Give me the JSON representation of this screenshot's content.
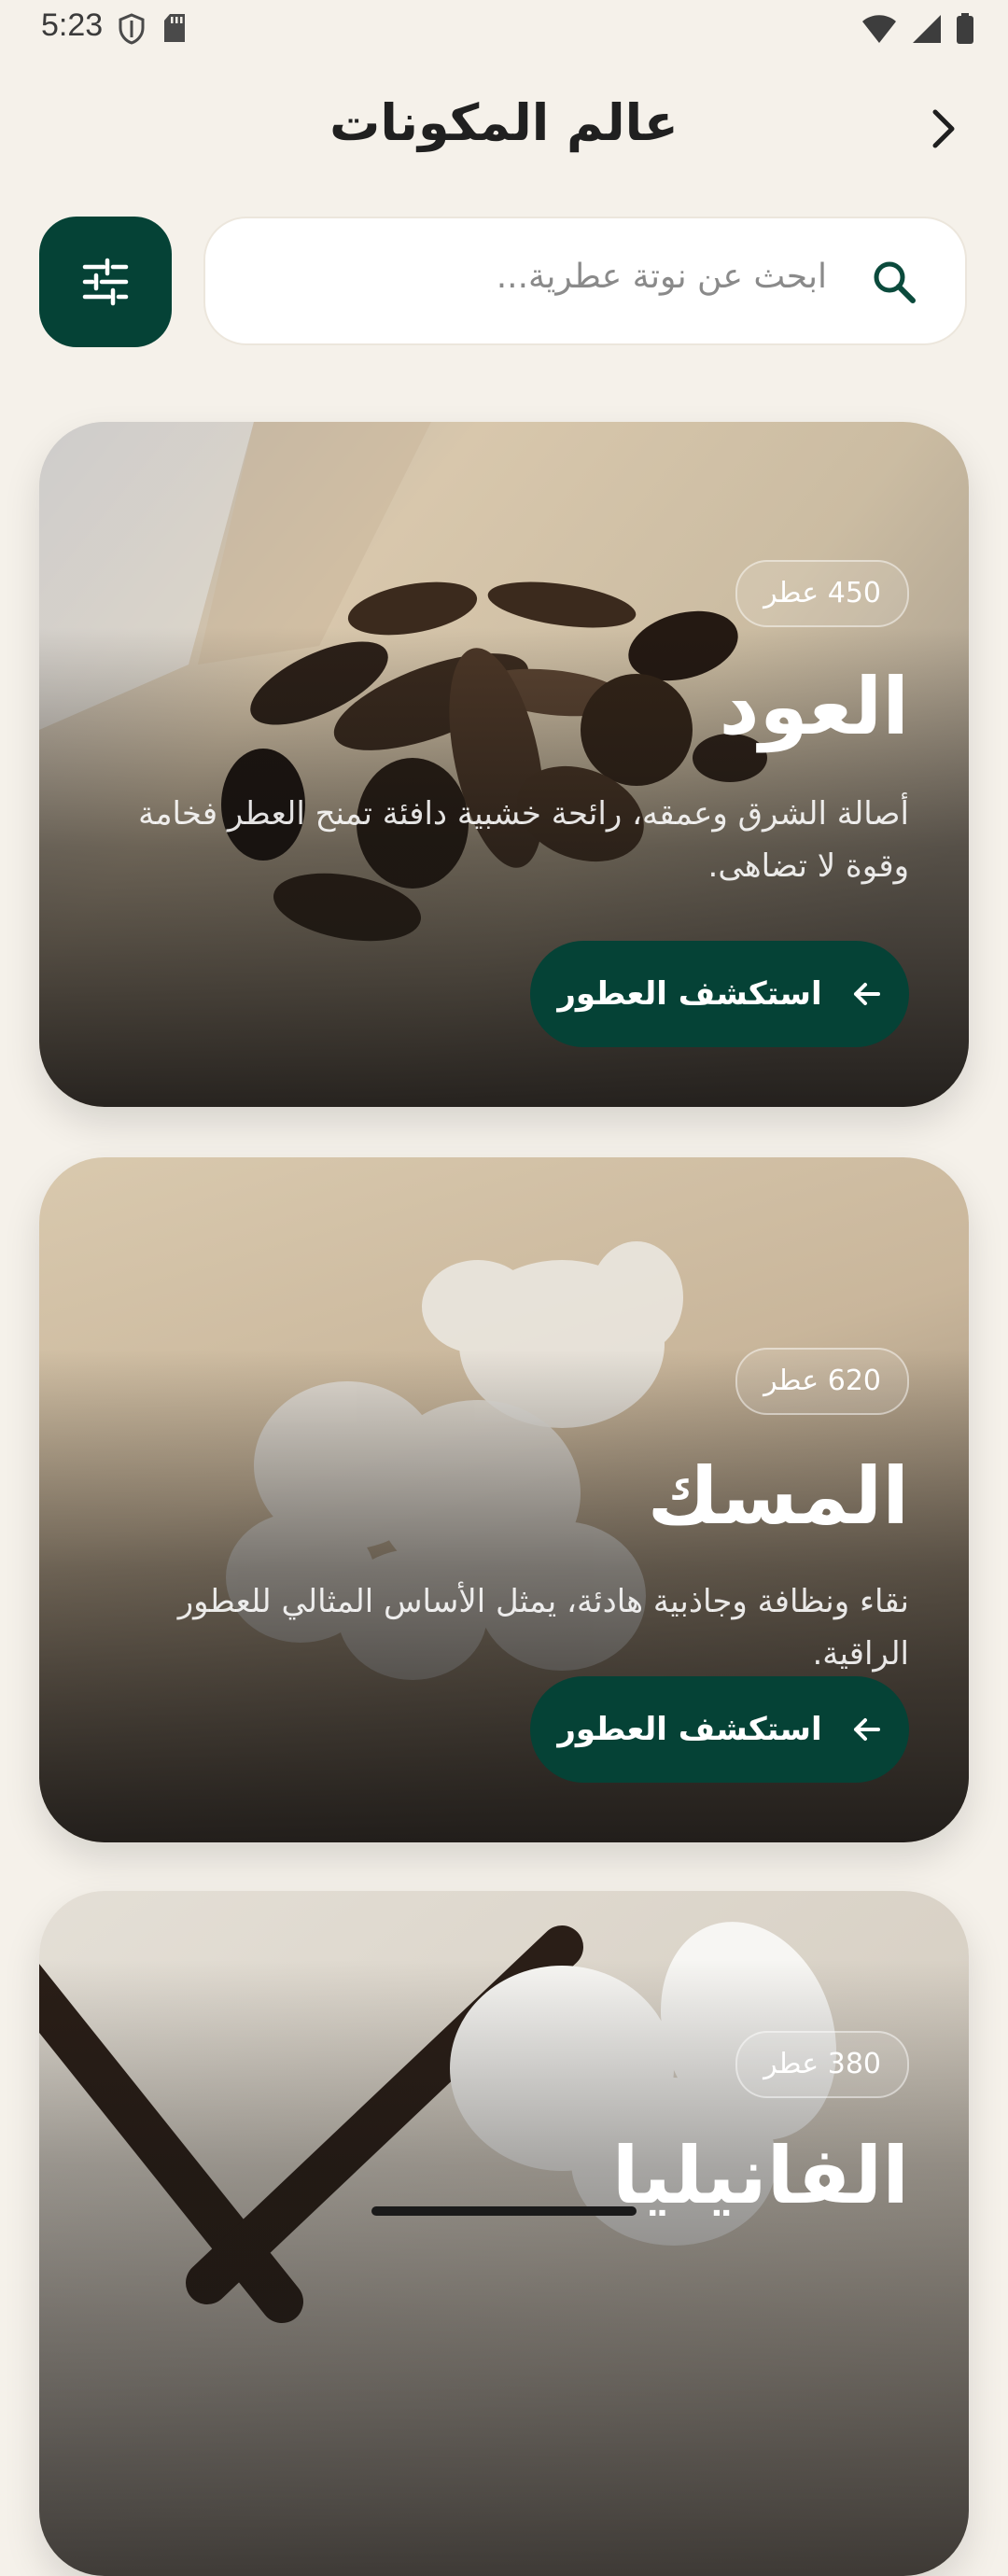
{
  "status_bar": {
    "time": "5:23"
  },
  "header": {
    "title": "عالم المكونات"
  },
  "search": {
    "placeholder": "ابحث عن نوتة عطرية..."
  },
  "cards": [
    {
      "count": "450 عطر",
      "title": "العود",
      "description": "أصالة الشرق وعمقه، رائحة خشبية دافئة تمنح العطر فخامة وقوة لا تضاهى.",
      "button": "استكشف العطور"
    },
    {
      "count": "620 عطر",
      "title": "المسك",
      "description": "نقاء ونظافة وجاذبية هادئة، يمثل الأساس المثالي للعطور الراقية.",
      "button": "استكشف العطور"
    },
    {
      "count": "380 عطر",
      "title": "الفانيليا"
    }
  ],
  "colors": {
    "accent": "#054236",
    "background": "#f5f1ea"
  }
}
